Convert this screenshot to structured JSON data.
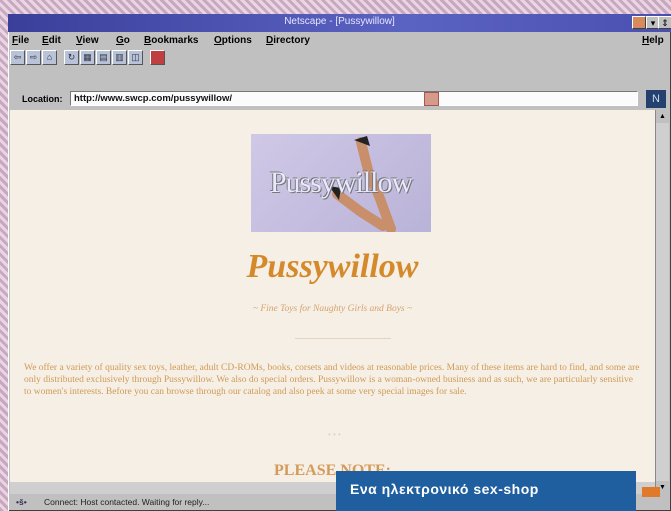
{
  "window": {
    "title": "Netscape - [Pussywillow]",
    "buttons": {
      "minimize": "▾",
      "restore": "⇕"
    }
  },
  "menu": {
    "items": [
      "File",
      "Edit",
      "View",
      "Go",
      "Bookmarks",
      "Options",
      "Directory"
    ],
    "help": "Help"
  },
  "location": {
    "label": "Location:",
    "url": "http://www.swcp.com/pussywillow/"
  },
  "page": {
    "banner_text": "Pussywillow",
    "title": "Pussywillow",
    "tagline": "~ Fine Toys for Naughty Girls and Boys ~",
    "body": "We offer a variety of quality sex toys, leather, adult CD-ROMs, books, corsets and videos at reasonable prices. Many of these items are hard to find, and some are only distributed exclusively through Pussywillow. We also do special orders. Pussywillow is a woman-owned business and as such, we are particularly sensitive to women's interests. Before you can browse through our catalog and also peek at some very special images for sale.",
    "note": "PLEASE NOTE:"
  },
  "status": {
    "icon": "•š•",
    "text": "Connect: Host contacted. Waiting for reply..."
  },
  "caption": {
    "text": "Ενα ηλεκτρονικό sex-shop"
  },
  "colors": {
    "title": "#d48a2a",
    "titlebar": "#4a50b0",
    "caption_bg": "#1f5fa0"
  }
}
